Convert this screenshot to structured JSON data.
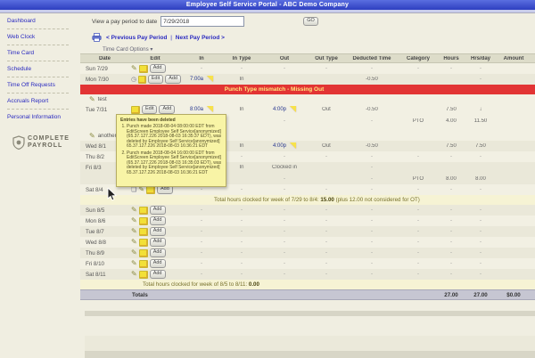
{
  "header": {
    "title": "Employee Self Service Portal - ABC Demo Company"
  },
  "sidebar": {
    "items": [
      {
        "label": "Dashboard"
      },
      {
        "label": "Web Clock"
      },
      {
        "label": "Time Card"
      },
      {
        "label": "Schedule"
      },
      {
        "label": "Time Off Requests"
      },
      {
        "label": "Accruals Report"
      },
      {
        "label": "Personal Information"
      }
    ],
    "logo_line1": "COMPLETE",
    "logo_line2": "PAYROLL"
  },
  "toolbar": {
    "pay_period_label": "View a pay period to date",
    "pay_period_value": "7/29/2018",
    "go_label": "GO",
    "prev_link": "< Previous Pay Period",
    "link_separator": "|",
    "next_link": "Next Pay Period >",
    "options_label": "Time Card Options ▾"
  },
  "colors": {
    "accent_blue": "#2a2ac0",
    "banner_red": "#e23434",
    "flag_yellow": "#f7e24a",
    "tooltip_yellow": "#f8f4a6"
  },
  "table": {
    "columns": [
      "Date",
      "Edit",
      "In",
      "In Type",
      "Out",
      "Out Type",
      "Deducted Time",
      "Category",
      "Hours",
      "Hrs/day",
      "Amount"
    ],
    "banner": "Punch Type mismatch - Missing Out",
    "rows": [
      {
        "t": "day",
        "date": "Sun 7/29",
        "icons": [
          "pencil",
          "note"
        ],
        "buttons": [
          "Add"
        ],
        "in": "-",
        "in_type": "-",
        "out": "-",
        "out_type": "-",
        "ded": "-",
        "cat": "-",
        "hrs": "-",
        "hday": "-",
        "amt": "",
        "shade": "a"
      },
      {
        "t": "day",
        "date": "Mon 7/30",
        "icons": [
          "clock",
          "note"
        ],
        "buttons": [
          "Edit",
          "Add"
        ],
        "in": "7:00a",
        "in_flag": true,
        "in_type": "In",
        "out": "",
        "out_type": "",
        "ded": "-0.50",
        "cat": "",
        "hrs": "",
        "hday": "-",
        "amt": "",
        "shade": "b"
      },
      {
        "t": "banner"
      },
      {
        "t": "note",
        "text": "test",
        "shade": "a"
      },
      {
        "t": "day",
        "date": "Tue 7/31",
        "icons": [
          "note"
        ],
        "buttons": [
          "Edit",
          "Add"
        ],
        "in": "8:00a",
        "in_flag": true,
        "in_type": "In",
        "out": "4:00p",
        "out_flag": true,
        "out_type": "Out",
        "ded": "-0.50",
        "cat": "",
        "hrs": "7.50",
        "hday": "↓",
        "amt": "",
        "shade": "a"
      },
      {
        "t": "sub",
        "in": "",
        "out": "-",
        "ded": "-",
        "cat": "PTO",
        "hrs": "4.00",
        "hday": "11.50",
        "shade": "a"
      },
      {
        "t": "spacer"
      },
      {
        "t": "note",
        "text": "another test",
        "shade": "a"
      },
      {
        "t": "day",
        "date": "Wed 8/1",
        "icons": [
          "pencil",
          "note"
        ],
        "buttons": [
          "Edit",
          "Add"
        ],
        "in": "",
        "in_type": "In",
        "out": "4:00p",
        "out_flag": true,
        "out_type": "Out",
        "ded": "-0.50",
        "cat": "",
        "hrs": "7.50",
        "hday": "7.50",
        "amt": "",
        "shade": "b"
      },
      {
        "t": "day",
        "date": "Thu 8/2",
        "icons": [
          "pencil",
          "note"
        ],
        "buttons": [
          "Add"
        ],
        "in": "-",
        "in_type": "-",
        "out": "-",
        "out_type": "-",
        "ded": "-",
        "cat": "-",
        "hrs": "-",
        "hday": "-",
        "amt": "",
        "shade": "a"
      },
      {
        "t": "day",
        "date": "Fri 8/3",
        "icons": [
          "pencil",
          "note"
        ],
        "buttons": [
          "Edit",
          "Add"
        ],
        "in": "",
        "in_type": "In",
        "out": "Clocked in",
        "out_plain": true,
        "out_type": "",
        "ded": "-",
        "cat": "",
        "hrs": "",
        "hday": "",
        "amt": "",
        "shade": "b"
      },
      {
        "t": "sub",
        "out": "-",
        "ded": "-",
        "cat": "PTO",
        "hrs": "8.00",
        "hday": "8.00",
        "shade": "b"
      },
      {
        "t": "day",
        "date": "Sat 8/4",
        "icons": [
          "doc",
          "pencil",
          "note"
        ],
        "buttons": [
          "Add"
        ],
        "in": "-",
        "in_type": "-",
        "out": "-",
        "out_type": "-",
        "ded": "-",
        "cat": "-",
        "hrs": "-",
        "hday": "-",
        "amt": "",
        "shade": "a"
      },
      {
        "t": "wk",
        "prefix": "Total hours clocked for week of 7/29 to 8/4:",
        "value": "15.00",
        "suffix": "(plus 12.00 not considered for OT)",
        "pad": 150
      },
      {
        "t": "day",
        "date": "Sun 8/5",
        "icons": [
          "pencil",
          "note"
        ],
        "buttons": [
          "Add"
        ],
        "in": "-",
        "in_type": "-",
        "out": "-",
        "out_type": "-",
        "ded": "-",
        "cat": "-",
        "hrs": "-",
        "hday": "-",
        "amt": "",
        "shade": "b"
      },
      {
        "t": "day",
        "date": "Mon 8/6",
        "icons": [
          "pencil",
          "note"
        ],
        "buttons": [
          "Add"
        ],
        "in": "-",
        "in_type": "-",
        "out": "-",
        "out_type": "-",
        "ded": "-",
        "cat": "-",
        "hrs": "-",
        "hday": "-",
        "amt": "",
        "shade": "a"
      },
      {
        "t": "day",
        "date": "Tue 8/7",
        "icons": [
          "pencil",
          "note"
        ],
        "buttons": [
          "Add"
        ],
        "in": "-",
        "in_type": "-",
        "out": "-",
        "out_type": "-",
        "ded": "-",
        "cat": "-",
        "hrs": "-",
        "hday": "-",
        "amt": "",
        "shade": "b"
      },
      {
        "t": "day",
        "date": "Wed 8/8",
        "icons": [
          "pencil",
          "note"
        ],
        "buttons": [
          "Add"
        ],
        "in": "-",
        "in_type": "-",
        "out": "-",
        "out_type": "-",
        "ded": "-",
        "cat": "-",
        "hrs": "-",
        "hday": "-",
        "amt": "",
        "shade": "a"
      },
      {
        "t": "day",
        "date": "Thu 8/9",
        "icons": [
          "pencil",
          "note"
        ],
        "buttons": [
          "Add"
        ],
        "in": "-",
        "in_type": "-",
        "out": "-",
        "out_type": "-",
        "ded": "-",
        "cat": "-",
        "hrs": "-",
        "hday": "-",
        "amt": "",
        "shade": "b"
      },
      {
        "t": "day",
        "date": "Fri 8/10",
        "icons": [
          "pencil",
          "note"
        ],
        "buttons": [
          "Add"
        ],
        "in": "-",
        "in_type": "-",
        "out": "-",
        "out_type": "-",
        "ded": "-",
        "cat": "-",
        "hrs": "-",
        "hday": "-",
        "amt": "",
        "shade": "a"
      },
      {
        "t": "day",
        "date": "Sat 8/11",
        "icons": [
          "pencil",
          "note"
        ],
        "buttons": [
          "Add"
        ],
        "in": "-",
        "in_type": "-",
        "out": "-",
        "out_type": "-",
        "ded": "-",
        "cat": "-",
        "hrs": "-",
        "hday": "-",
        "amt": "",
        "shade": "b"
      },
      {
        "t": "wk",
        "prefix": "Total hours clocked for week of 8/5 to 8/11:",
        "value": "0.00",
        "suffix": "",
        "pad": 70
      },
      {
        "t": "totals"
      }
    ],
    "totals_label": "Totals",
    "totals_hours": "27.00",
    "totals_hrsday": "27.00",
    "totals_amount": "$0.00"
  },
  "tooltip": {
    "title": "Entries have been deleted",
    "items": [
      "Punch made 2018-08-04 08:00:00 EDT from EditScreen Employee Self Service[anonymized] (65.37.127.226 2018-08-03 16:35:37 EDT), was deleted by Employee Self Service[anonymized] 65.37.127.226 2018-08-03 16:36:21 EDT",
      "Punch made 2018-08-04 16:00:00 EDT from EditScreen Employee Self Service[anonymized] (65.37.127.226 2018-08-03 16:35:03 EDT), was deleted by Employee Self Service[anonymized] 65.37.127.226 2018-08-03 16:36:21 EDT"
    ]
  }
}
